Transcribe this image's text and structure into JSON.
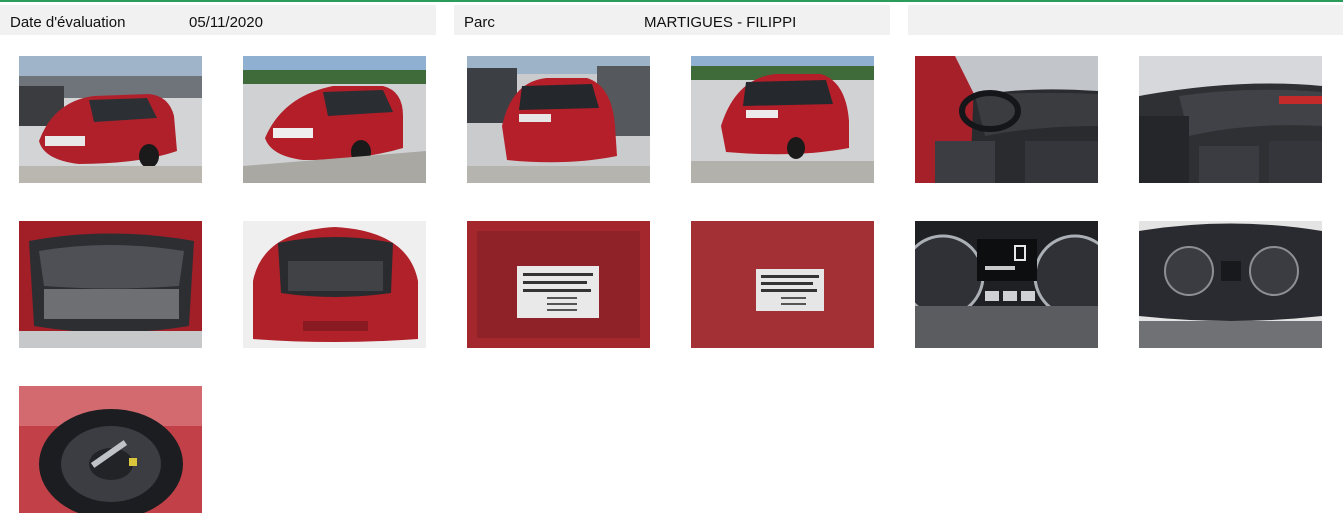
{
  "header": {
    "date_label": "Date d'évaluation",
    "date_value": "05/11/2020",
    "parc_label": "Parc",
    "parc_value": "MARTIGUES - FILIPPI"
  },
  "photos": [
    {
      "name": "photo-front-left",
      "scene": "car-front"
    },
    {
      "name": "photo-front-right",
      "scene": "car-front-2"
    },
    {
      "name": "photo-rear-left",
      "scene": "car-rear"
    },
    {
      "name": "photo-rear-right",
      "scene": "car-rear-2"
    },
    {
      "name": "photo-interior-driver",
      "scene": "interior"
    },
    {
      "name": "photo-interior-passenger",
      "scene": "interior-2"
    },
    {
      "name": "photo-trunk-open",
      "scene": "trunk"
    },
    {
      "name": "photo-trunk-rear",
      "scene": "trunk-2"
    },
    {
      "name": "photo-vin-plate",
      "scene": "plate"
    },
    {
      "name": "photo-vin-plate-2",
      "scene": "plate-2"
    },
    {
      "name": "photo-dashboard-cluster",
      "scene": "dash"
    },
    {
      "name": "photo-dashboard-cluster-2",
      "scene": "dash-2"
    },
    {
      "name": "photo-spare-wheel",
      "scene": "spare"
    }
  ],
  "colors": {
    "accent_line": "#2a9d5c",
    "header_bg": "#f1f1f1",
    "car_red": "#b0202a",
    "dark_interior": "#2a2b2f"
  }
}
